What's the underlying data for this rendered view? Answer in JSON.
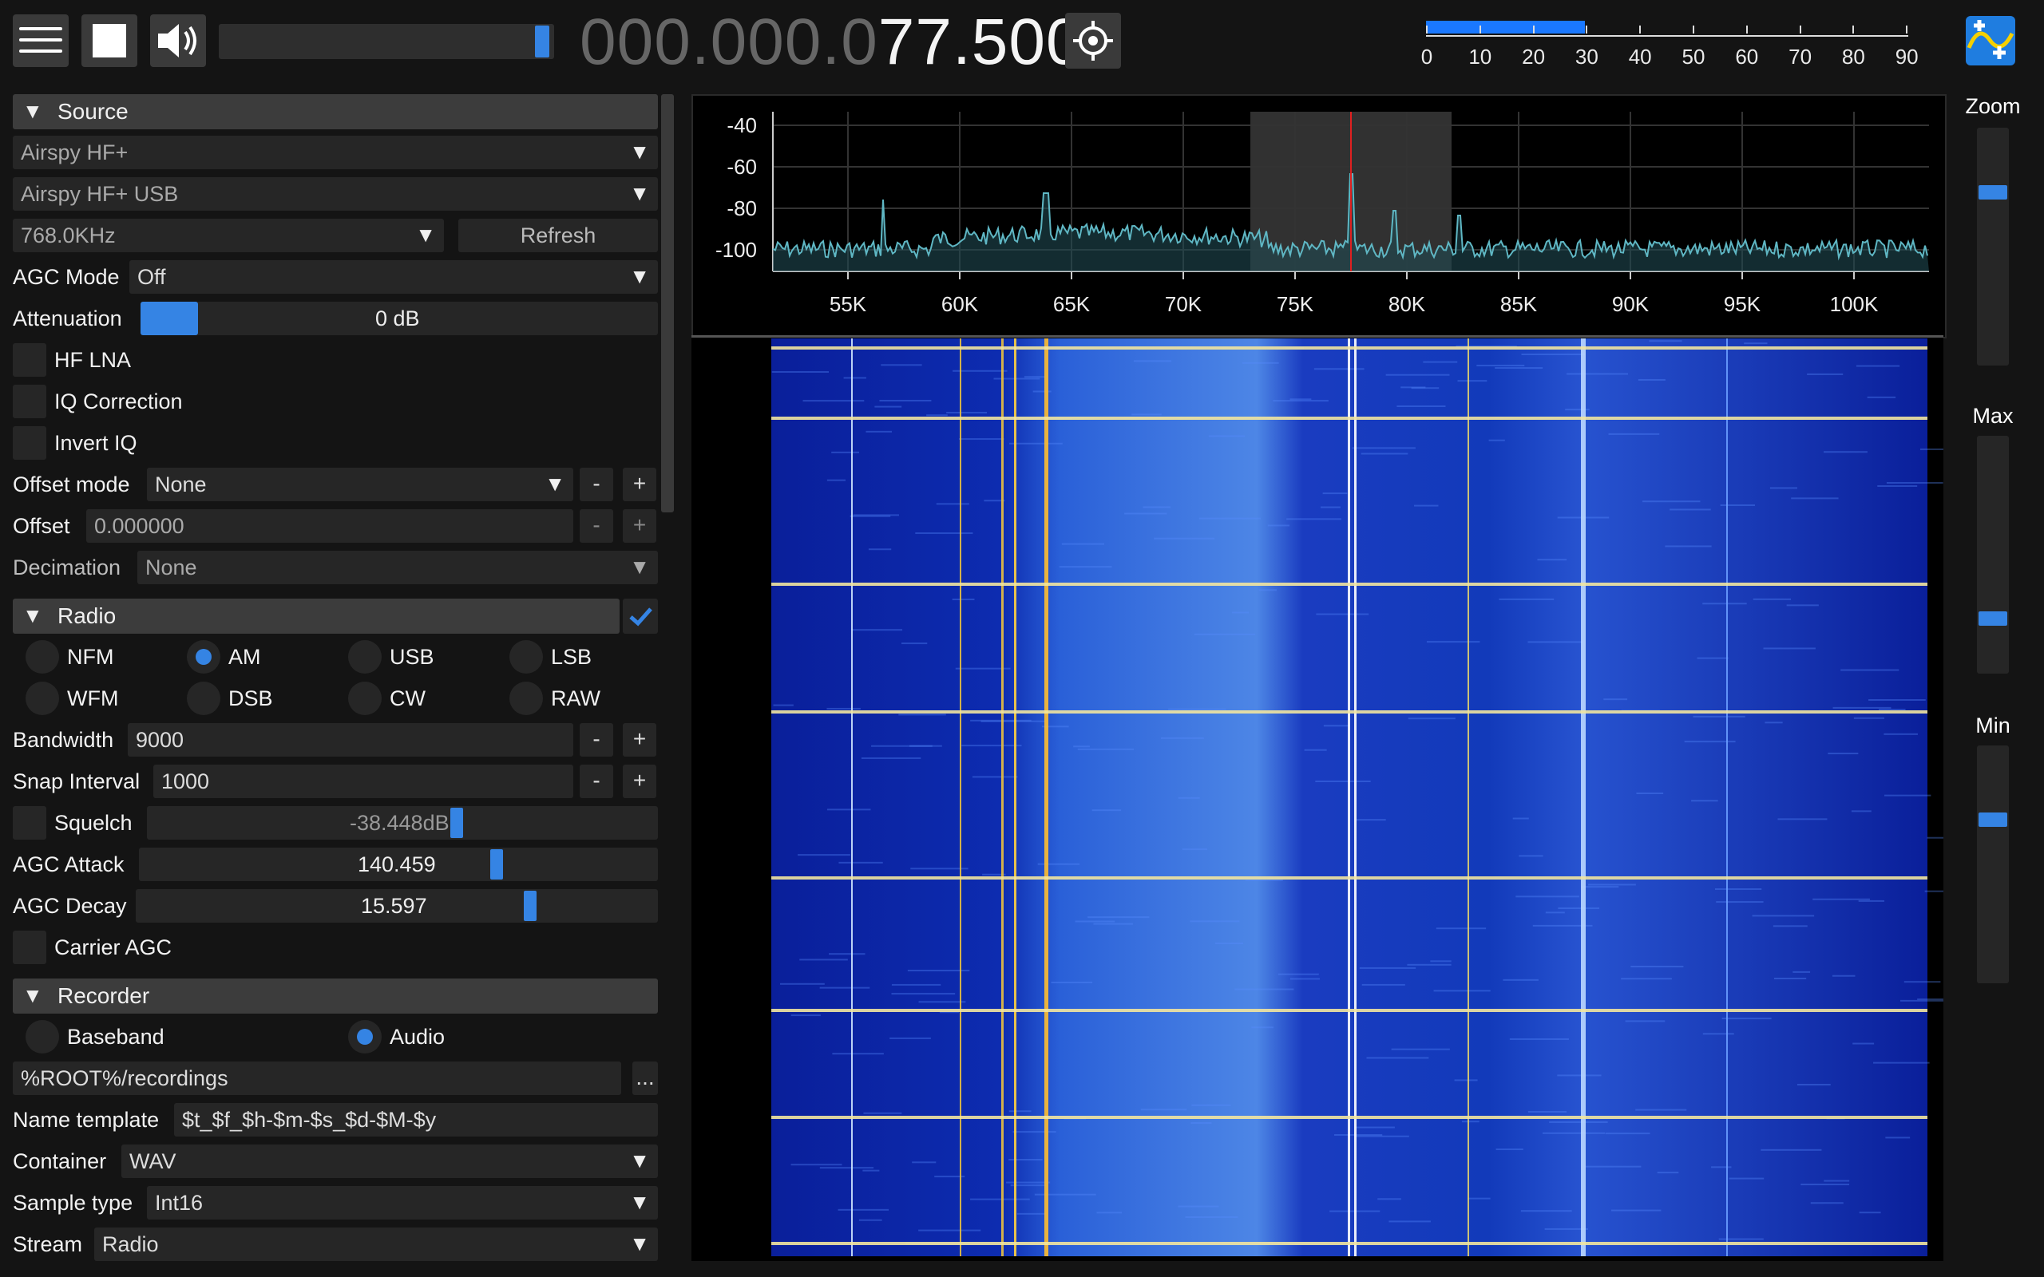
{
  "toolbar": {
    "freq_dim": "000.000.0",
    "freq_bright": "77.500",
    "snr_ticks": [
      "0",
      "10",
      "20",
      "30",
      "40",
      "50",
      "60",
      "70",
      "80",
      "90"
    ],
    "snr_level_pct": 33
  },
  "source": {
    "header": "Source",
    "device": "Airspy HF+",
    "device_port": "Airspy HF+ USB",
    "samplerate": "768.0KHz",
    "refresh": "Refresh",
    "agc_mode_label": "AGC Mode",
    "agc_mode": "Off",
    "attenuation_label": "Attenuation",
    "attenuation": "0 dB",
    "hf_lna": "HF LNA",
    "iq_correction": "IQ Correction",
    "invert_iq": "Invert IQ",
    "offset_mode_label": "Offset mode",
    "offset_mode": "None",
    "offset_label": "Offset",
    "offset": "0.000000",
    "decimation_label": "Decimation",
    "decimation": "None",
    "minus": "-",
    "plus": "+"
  },
  "radio": {
    "header": "Radio",
    "modes": [
      "NFM",
      "AM",
      "USB",
      "LSB",
      "WFM",
      "DSB",
      "CW",
      "RAW"
    ],
    "selected_mode": "AM",
    "bandwidth_label": "Bandwidth",
    "bandwidth": "9000",
    "snap_label": "Snap Interval",
    "snap": "1000",
    "squelch_label": "Squelch",
    "squelch": "-38.448dB",
    "agc_attack_label": "AGC Attack",
    "agc_attack": "140.459",
    "agc_decay_label": "AGC Decay",
    "agc_decay": "15.597",
    "carrier_agc": "Carrier AGC"
  },
  "recorder": {
    "header": "Recorder",
    "baseband": "Baseband",
    "audio": "Audio",
    "path": "%ROOT%/recordings",
    "browse": "...",
    "name_template_label": "Name template",
    "name_template": "$t_$f_$h-$m-$s_$d-$M-$y",
    "container_label": "Container",
    "container": "WAV",
    "sample_type_label": "Sample type",
    "sample_type": "Int16",
    "stream_label": "Stream",
    "stream": "Radio"
  },
  "spectrum": {
    "y_ticks": [
      "-40",
      "-60",
      "-80",
      "-100"
    ],
    "x_ticks": [
      "55K",
      "60K",
      "65K",
      "70K",
      "75K",
      "80K",
      "85K",
      "90K",
      "95K",
      "100K"
    ]
  },
  "right": {
    "zoom": "Zoom",
    "max": "Max",
    "min": "Min"
  },
  "colors": {
    "accent": "#3584e4",
    "spectrum_line": "#5fb7c4",
    "tuning_marker": "#e02020"
  }
}
